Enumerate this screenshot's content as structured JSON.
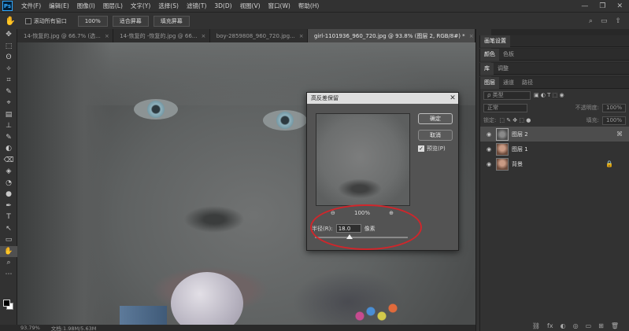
{
  "app": {
    "logo": "Ps"
  },
  "menu": [
    "文件(F)",
    "编辑(E)",
    "图像(I)",
    "图层(L)",
    "文字(Y)",
    "选择(S)",
    "滤镜(T)",
    "3D(D)",
    "视图(V)",
    "窗口(W)",
    "帮助(H)"
  ],
  "window_controls": [
    "—",
    "❐",
    "✕"
  ],
  "options": {
    "scroll_all_label": "滚动所有窗口",
    "zoom_value": "100%",
    "fit_screen": "适合屏幕",
    "fill_screen": "填充屏幕",
    "right_icons": [
      "⌕",
      "▭",
      "⇧"
    ]
  },
  "tabs": [
    {
      "label": "14-恢复的.jpg @ 66.7% (选...",
      "active": false
    },
    {
      "label": "14-恢复的 -恢复的.jpg @ 66...",
      "active": false
    },
    {
      "label": "boy-2859808_960_720.jpg...",
      "active": false
    },
    {
      "label": "girl-1101936_960_720.jpg @ 93.8% (图层 2, RGB/8#) *",
      "active": true
    }
  ],
  "tab_close": "×",
  "tools": [
    "✥",
    "⬚",
    "ʘ",
    "✧",
    "⌗",
    "✎",
    "⌖",
    "▤",
    "⊥",
    "✎",
    "◐",
    "⌫",
    "◈",
    "◔",
    "●",
    "✒",
    "T",
    "↖",
    "▭",
    "✋",
    "⌕",
    "⋯"
  ],
  "status": {
    "zoom": "93.79%",
    "doc": "文档:1.98M/5.63M"
  },
  "side_icons": [
    "▥",
    "◉",
    "▦",
    "▤",
    "◧",
    "☰"
  ],
  "panels": {
    "brush": [
      "画笔设置"
    ],
    "color": [
      "颜色",
      "色板"
    ],
    "library": [
      "库",
      "调整"
    ],
    "layers_tabs": [
      "图层",
      "通道",
      "路径"
    ]
  },
  "layers": {
    "filter_label": "ρ 类型",
    "filter_icons": "▣ ◐ T ⬚ ◉",
    "blend_mode": "正常",
    "opacity_label": "不透明度:",
    "opacity_value": "100%",
    "lock_label": "锁定:",
    "lock_icons": "⬚ ✎ ✥ ⬚ ●",
    "fill_label": "填充:",
    "fill_value": "100%",
    "items": [
      {
        "name": "图层 2",
        "selected": true
      },
      {
        "name": "图层 1",
        "selected": false
      },
      {
        "name": "背景",
        "selected": false
      }
    ],
    "eye": "◉",
    "link": "⌘",
    "lock": "🔒",
    "footer_icons": [
      "⛓",
      "fx",
      "◐",
      "◎",
      "▭",
      "⊞",
      "🗑"
    ]
  },
  "dialog": {
    "title": "高反差保留",
    "close": "✕",
    "ok": "确定",
    "cancel": "取消",
    "preview_label": "预览(P)",
    "preview_checked": "✓",
    "zoom_out": "⊖",
    "zoom_value": "100%",
    "zoom_in": "⊕",
    "radius_label": "半径(R):",
    "radius_value": "18.0",
    "radius_unit": "像素",
    "slider_level": 0.37
  },
  "colors": {
    "annotation": "#d0262b",
    "panel": "#323232",
    "selected_layer": "#4d4d4d"
  }
}
